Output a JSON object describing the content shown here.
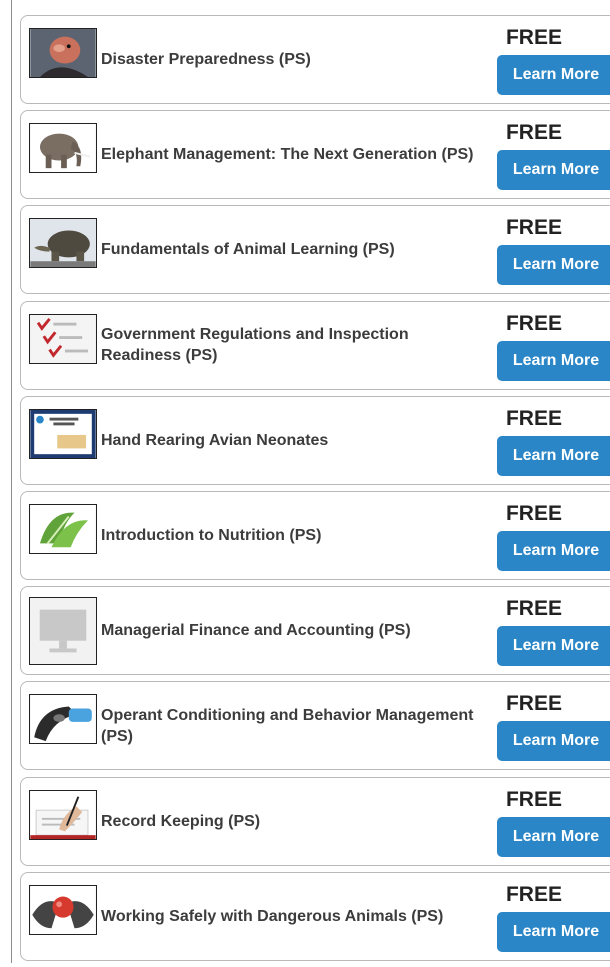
{
  "courses": [
    {
      "title": "Disaster Preparedness (PS)",
      "price": "FREE",
      "button": "Learn More",
      "thumb": "vulture-thumbnail"
    },
    {
      "title": "Elephant Management: The Next Generation (PS)",
      "price": "FREE",
      "button": "Learn More",
      "thumb": "elephant-thumbnail"
    },
    {
      "title": "Fundamentals of Animal Learning (PS)",
      "price": "FREE",
      "button": "Learn More",
      "thumb": "tortoise-thumbnail"
    },
    {
      "title": "Government Regulations and Inspection Readiness (PS)",
      "price": "FREE",
      "button": "Learn More",
      "thumb": "checklist-thumbnail"
    },
    {
      "title": "Hand Rearing Avian Neonates",
      "price": "FREE",
      "button": "Learn More",
      "thumb": "slide-thumbnail"
    },
    {
      "title": "Introduction to Nutrition (PS)",
      "price": "FREE",
      "button": "Learn More",
      "thumb": "lettuce-thumbnail"
    },
    {
      "title": "Managerial Finance and Accounting (PS)",
      "price": "FREE",
      "button": "Learn More",
      "thumb": "monitor-placeholder-thumbnail"
    },
    {
      "title": "Operant Conditioning and Behavior Management (PS)",
      "price": "FREE",
      "button": "Learn More",
      "thumb": "clicker-thumbnail"
    },
    {
      "title": "Record Keeping (PS)",
      "price": "FREE",
      "button": "Learn More",
      "thumb": "writing-hand-thumbnail"
    },
    {
      "title": "Working Safely with Dangerous Animals (PS)",
      "price": "FREE",
      "button": "Learn More",
      "thumb": "hands-ball-thumbnail"
    }
  ],
  "colors": {
    "button": "#2a86c7",
    "border": "#b9b9b9",
    "title": "#3c3c3c"
  }
}
